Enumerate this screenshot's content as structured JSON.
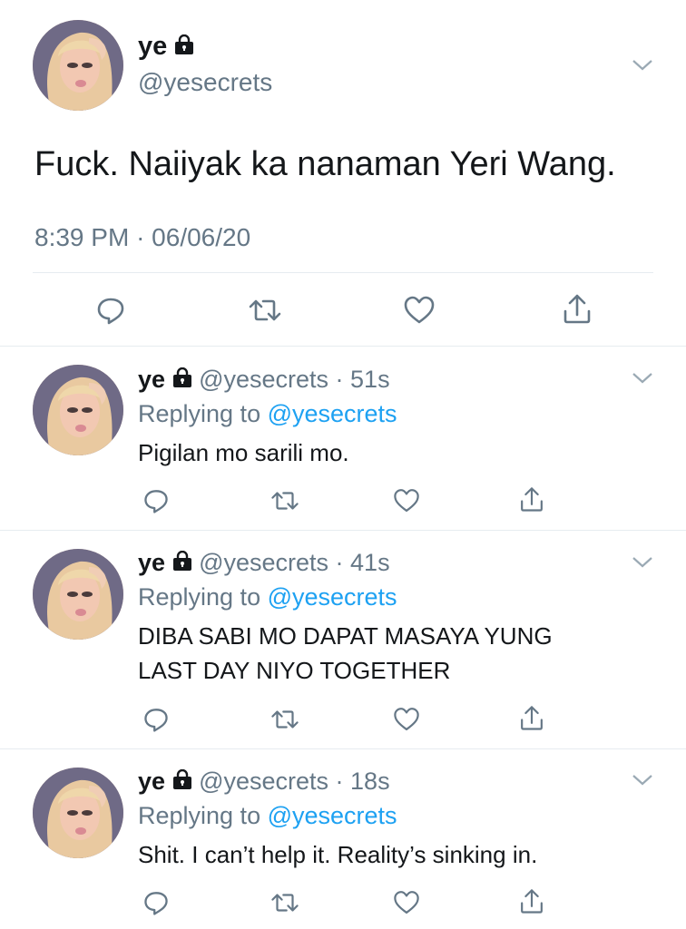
{
  "main_tweet": {
    "display_name": "ye",
    "handle": "@yesecrets",
    "text": "Fuck. Naiiyak ka nanaman Yeri Wang.",
    "time": "8:39 PM",
    "separator": "·",
    "date": "06/06/20"
  },
  "replies": [
    {
      "display_name": "ye",
      "handle": "@yesecrets",
      "age": "51s",
      "replying_label": "Replying to",
      "replying_handle": "@yesecrets",
      "text": "Pigilan mo sarili mo."
    },
    {
      "display_name": "ye",
      "handle": "@yesecrets",
      "age": "41s",
      "replying_label": "Replying to",
      "replying_handle": "@yesecrets",
      "text": "DIBA SABI MO DAPAT MASAYA YUNG LAST DAY NIYO TOGETHER"
    },
    {
      "display_name": "ye",
      "handle": "@yesecrets",
      "age": "18s",
      "replying_label": "Replying to",
      "replying_handle": "@yesecrets",
      "text": "Shit. I can’t help it. Reality’s sinking in."
    }
  ],
  "colors": {
    "accent": "#1da1f2",
    "muted": "#657786",
    "icon": "#657786",
    "divider": "#e6ecf0"
  },
  "icons": [
    "lock-icon",
    "chevron-down-icon",
    "reply-icon",
    "retweet-icon",
    "like-icon",
    "share-icon"
  ]
}
